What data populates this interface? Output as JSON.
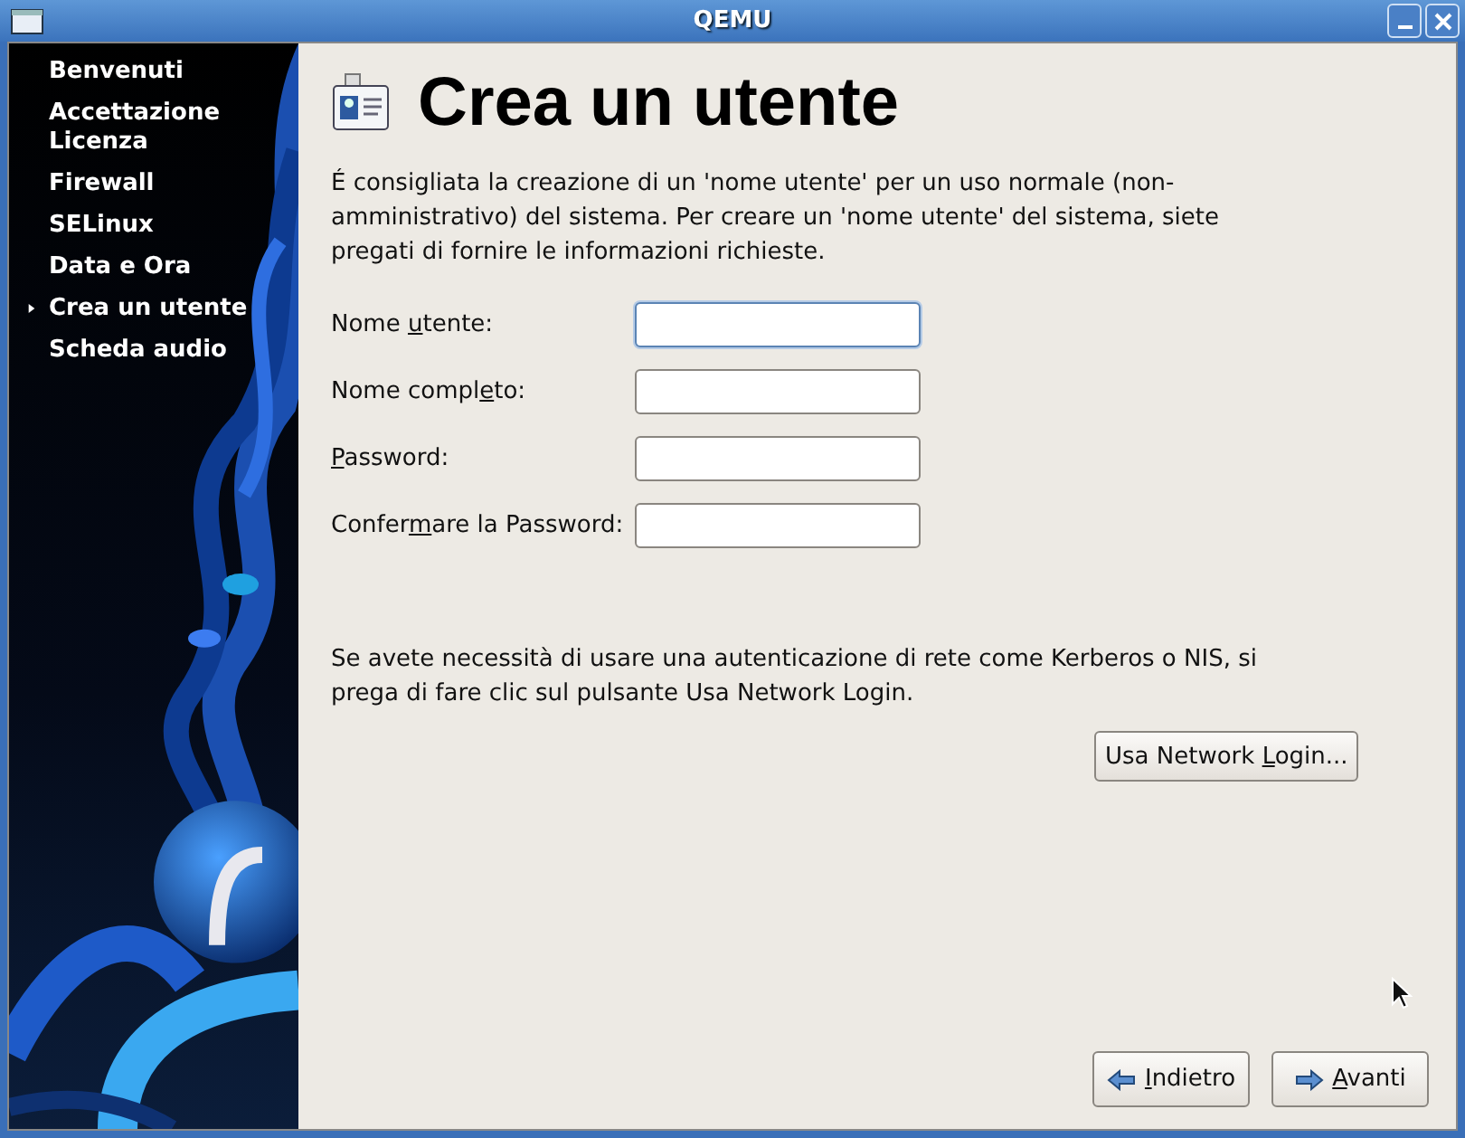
{
  "window": {
    "title": "QEMU"
  },
  "sidebar": {
    "items": [
      {
        "label": "Benvenuti",
        "selected": false
      },
      {
        "label": "Accettazione Licenza",
        "selected": false
      },
      {
        "label": "Firewall",
        "selected": false
      },
      {
        "label": "SELinux",
        "selected": false
      },
      {
        "label": "Data e Ora",
        "selected": false
      },
      {
        "label": "Crea un utente",
        "selected": true
      },
      {
        "label": "Scheda audio",
        "selected": false
      }
    ]
  },
  "page": {
    "title": "Crea un utente",
    "intro": "É consigliata la creazione di un 'nome utente' per un uso normale (non-amministrativo) del sistema. Per creare un 'nome utente' del sistema, siete pregati di fornire le informazioni richieste.",
    "fields": [
      {
        "label": {
          "before": "Nome ",
          "key": "u",
          "after": "tente:"
        },
        "focused": true
      },
      {
        "label": {
          "before": "Nome compl",
          "key": "e",
          "after": "to:"
        },
        "focused": false
      },
      {
        "label": {
          "key": "P",
          "after": "assword:"
        },
        "focused": false
      },
      {
        "label": {
          "before": "Confer",
          "key": "m",
          "after": "are la Password:"
        },
        "focused": false
      }
    ],
    "network_note": "Se avete necessità di usare una autenticazione di rete come Kerberos o NIS, si prega di fare clic sul pulsante Usa Network Login.",
    "network_button": {
      "before": "Usa Network ",
      "key": "L",
      "after": "ogin..."
    }
  },
  "buttons": [
    {
      "kind": "back",
      "label": {
        "key": "I",
        "after": "ndietro"
      }
    },
    {
      "kind": "next",
      "label": {
        "key": "A",
        "after": "vanti"
      }
    }
  ]
}
